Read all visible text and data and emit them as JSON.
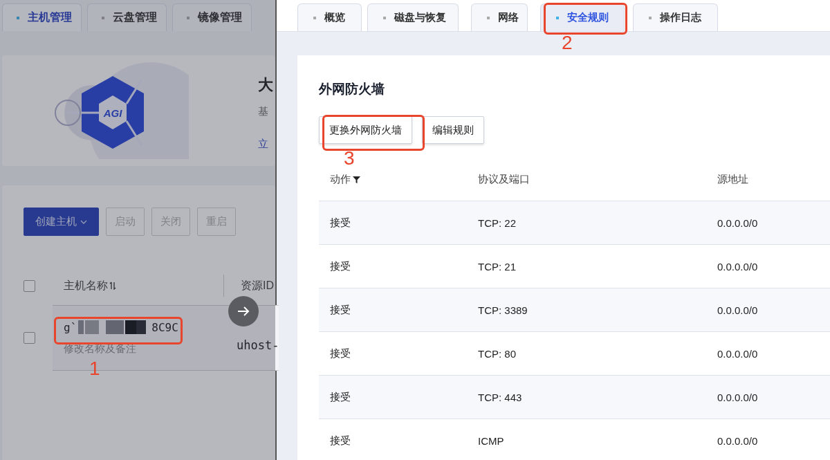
{
  "host_panel": {
    "tabs": [
      {
        "label": "主机管理",
        "selected": true
      },
      {
        "label": "云盘管理",
        "selected": false
      },
      {
        "label": "镜像管理",
        "selected": false
      }
    ],
    "banner": {
      "logo_text": "AGI",
      "title": "大",
      "description": "基",
      "link": "立"
    },
    "toolbar": [
      {
        "label": "创建主机",
        "kind": "primary"
      },
      {
        "label": "启动",
        "kind": "disabled"
      },
      {
        "label": "关闭",
        "kind": "disabled"
      },
      {
        "label": "重启",
        "kind": "disabled"
      }
    ],
    "table": {
      "all_checked": false,
      "columns": [
        "主机名称",
        "资源ID"
      ],
      "rows": [
        {
          "checked": false,
          "name_start": "g`",
          "name_end": "8C9C",
          "note": "修改名称及备注",
          "resource_id": "uhost-"
        }
      ]
    }
  },
  "drawer": {
    "tabs": [
      {
        "label": "概览",
        "selected": false
      },
      {
        "label": "磁盘与恢复",
        "selected": false
      },
      {
        "label": "网络",
        "selected": false
      },
      {
        "label": "安全规则",
        "selected": true
      },
      {
        "label": "操作日志",
        "selected": false
      }
    ],
    "section_title": "外网防火墙",
    "buttons": [
      "更换外网防火墙",
      "编辑规则"
    ],
    "table": {
      "columns": [
        "动作",
        "协议及端口",
        "源地址"
      ],
      "rows": [
        {
          "action": "接受",
          "protocol": "TCP: 22",
          "source": "0.0.0.0/0"
        },
        {
          "action": "接受",
          "protocol": "TCP: 21",
          "source": "0.0.0.0/0"
        },
        {
          "action": "接受",
          "protocol": "TCP: 3389",
          "source": "0.0.0.0/0"
        },
        {
          "action": "接受",
          "protocol": "TCP: 80",
          "source": "0.0.0.0/0"
        },
        {
          "action": "接受",
          "protocol": "TCP: 443",
          "source": "0.0.0.0/0"
        },
        {
          "action": "接受",
          "protocol": "ICMP",
          "source": "0.0.0.0/0"
        }
      ]
    }
  },
  "annotations": [
    {
      "number": "1"
    },
    {
      "number": "2"
    },
    {
      "number": "3"
    }
  ]
}
